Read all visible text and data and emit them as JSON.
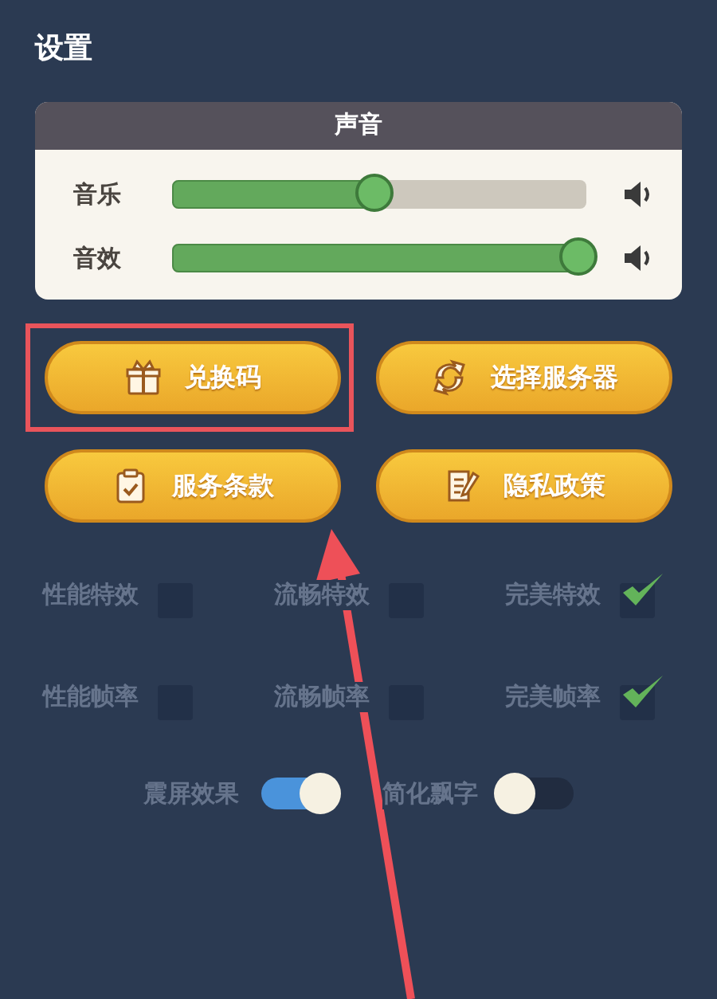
{
  "title": "设置",
  "sound": {
    "title": "声音",
    "sliders": [
      {
        "label": "音乐",
        "level": 0.49
      },
      {
        "label": "音效",
        "level": 0.98
      }
    ]
  },
  "buttons": [
    {
      "label": "兑换码",
      "highlighted": true
    },
    {
      "label": "选择服务器",
      "highlighted": false
    },
    {
      "label": "服务条款",
      "highlighted": false
    },
    {
      "label": "隐私政策",
      "highlighted": false
    }
  ],
  "options": [
    {
      "label": "性能特效",
      "checked": false
    },
    {
      "label": "流畅特效",
      "checked": false
    },
    {
      "label": "完美特效",
      "checked": true
    },
    {
      "label": "性能帧率",
      "checked": false
    },
    {
      "label": "流畅帧率",
      "checked": false
    },
    {
      "label": "完美帧率",
      "checked": true
    }
  ],
  "toggles": [
    {
      "label": "震屏效果",
      "on": true
    },
    {
      "label": "简化飘字",
      "on": false
    }
  ]
}
